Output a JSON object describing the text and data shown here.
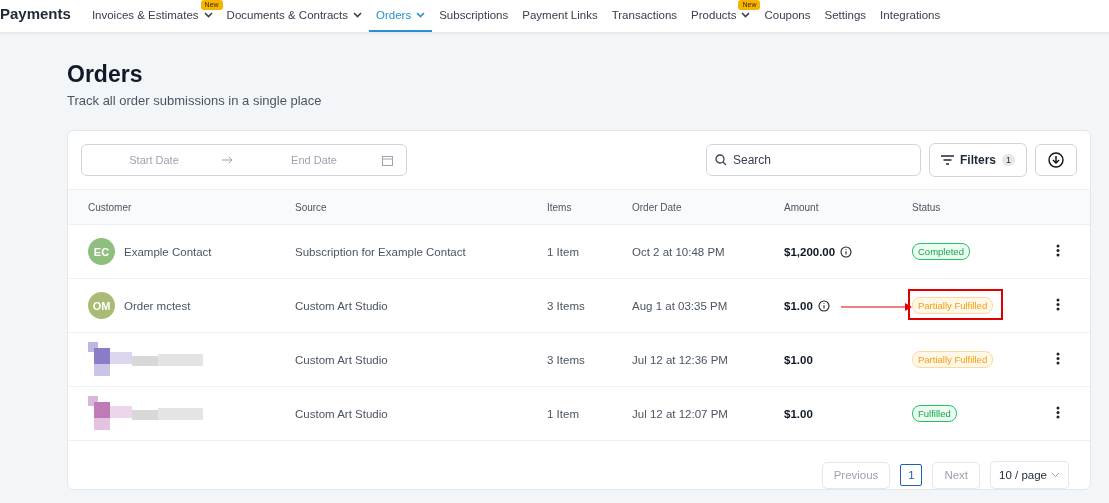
{
  "app_title": "Payments",
  "nav": [
    {
      "label": "Invoices & Estimates",
      "dropdown": true,
      "badge": "New",
      "selected": false
    },
    {
      "label": "Documents & Contracts",
      "dropdown": true,
      "selected": false
    },
    {
      "label": "Orders",
      "dropdown": true,
      "selected": true
    },
    {
      "label": "Subscriptions",
      "dropdown": false,
      "selected": false
    },
    {
      "label": "Payment Links",
      "dropdown": false,
      "selected": false
    },
    {
      "label": "Transactions",
      "dropdown": false,
      "selected": false
    },
    {
      "label": "Products",
      "dropdown": true,
      "badge": "New",
      "selected": false
    },
    {
      "label": "Coupons",
      "dropdown": false,
      "selected": false
    },
    {
      "label": "Settings",
      "dropdown": false,
      "selected": false
    },
    {
      "label": "Integrations",
      "dropdown": false,
      "selected": false
    }
  ],
  "page": {
    "title": "Orders",
    "subtitle": "Track all order submissions in a single place"
  },
  "toolbar": {
    "start_placeholder": "Start Date",
    "end_placeholder": "End Date",
    "search_placeholder": "Search",
    "filters_label": "Filters",
    "filters_count": "1"
  },
  "table": {
    "columns": [
      "Customer",
      "Source",
      "Items",
      "Order Date",
      "Amount",
      "Status"
    ],
    "rows": [
      {
        "customer": {
          "kind": "contact",
          "initials": "EC",
          "name": "Example Contact",
          "color": "#8fbf7f"
        },
        "source": "Subscription for Example Contact",
        "items": "1 Item",
        "date": "Oct 2 at 10:48 PM",
        "amount": "$1,200.00",
        "info": true,
        "status": {
          "label": "Completed",
          "kind": "success"
        },
        "highlighted": false
      },
      {
        "customer": {
          "kind": "contact",
          "initials": "OM",
          "name": "Order mctest",
          "color": "#a9bb74"
        },
        "source": "Custom Art Studio",
        "items": "3 Items",
        "date": "Aug 1 at 03:35 PM",
        "amount": "$1.00",
        "info": true,
        "status": {
          "label": "Partially Fulfilled",
          "kind": "warning"
        },
        "highlighted": true
      },
      {
        "customer": {
          "kind": "redacted",
          "color": "#8a7cc6"
        },
        "source": "Custom Art Studio",
        "items": "3 Items",
        "date": "Jul 12 at 12:36 PM",
        "amount": "$1.00",
        "info": false,
        "status": {
          "label": "Partially Fulfilled",
          "kind": "warning"
        },
        "highlighted": false
      },
      {
        "customer": {
          "kind": "redacted",
          "color": "#c07ab8"
        },
        "source": "Custom Art Studio",
        "items": "1 Item",
        "date": "Jul 12 at 12:07 PM",
        "amount": "$1.00",
        "info": false,
        "status": {
          "label": "Fulfilled",
          "kind": "success"
        },
        "highlighted": false
      }
    ]
  },
  "pagination": {
    "previous": "Previous",
    "pages": [
      {
        "label": "1",
        "selected": true
      }
    ],
    "next": "Next",
    "page_size": "10 / page"
  }
}
